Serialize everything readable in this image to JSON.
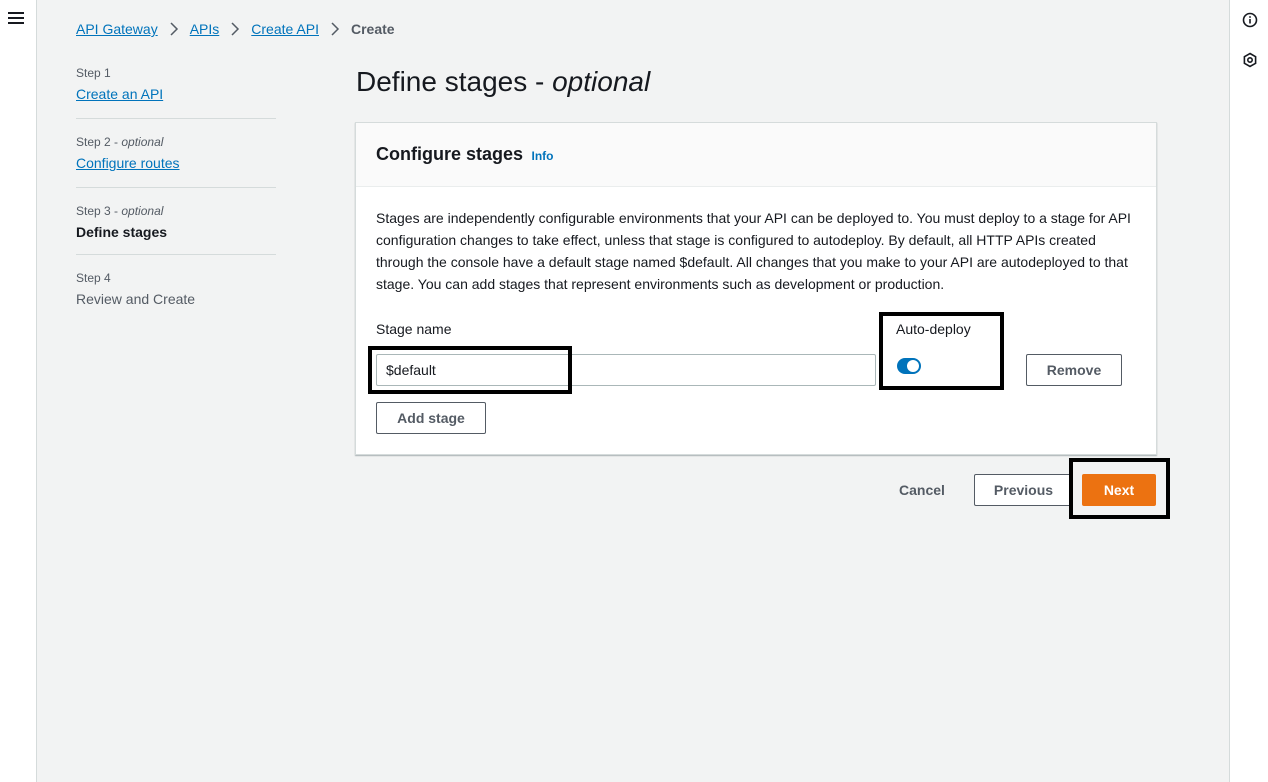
{
  "breadcrumb": {
    "items": [
      "API Gateway",
      "APIs",
      "Create API"
    ],
    "current": "Create"
  },
  "steps": [
    {
      "num": "Step 1",
      "optional": "",
      "label": "Create an API"
    },
    {
      "num": "Step 2 -",
      "optional": "optional",
      "label": "Configure routes"
    },
    {
      "num": "Step 3 -",
      "optional": "optional",
      "label": "Define stages"
    },
    {
      "num": "Step 4",
      "optional": "",
      "label": "Review and Create"
    }
  ],
  "page": {
    "title": "Define stages -",
    "title_italic": "optional"
  },
  "panel": {
    "title": "Configure stages",
    "info": "Info",
    "description": "Stages are independently configurable environments that your API can be deployed to. You must deploy to a stage for API configuration changes to take effect, unless that stage is configured to autodeploy. By default, all HTTP APIs created through the console have a default stage named $default. All changes that you make to your API are autodeployed to that stage. You can add stages that represent environments such as development or production.",
    "stage_name_label": "Stage name",
    "stage_name_value": "$default",
    "auto_deploy_label": "Auto-deploy",
    "auto_deploy_on": true,
    "remove_label": "Remove",
    "add_stage_label": "Add stage"
  },
  "footer": {
    "cancel_label": "Cancel",
    "previous_label": "Previous",
    "next_label": "Next"
  },
  "icons": {
    "menu": "menu-icon",
    "info": "info-circle-icon",
    "feedback": "hexagon-settings-icon",
    "breadcrumb_sep": "chevron-right-icon"
  },
  "colors": {
    "link": "#0073bb",
    "primary": "#ec7211",
    "toggle_on": "#0073bb",
    "highlight": "#000000"
  }
}
